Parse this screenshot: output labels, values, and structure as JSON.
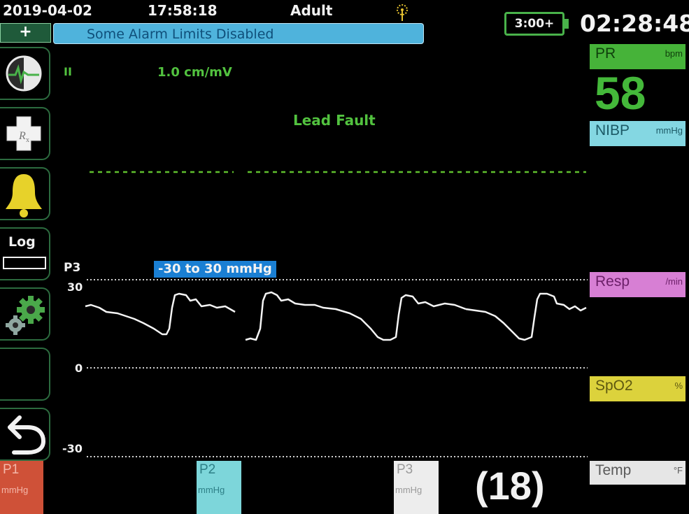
{
  "status_bar": {
    "date": "2019-04-02",
    "time": "17:58:18",
    "patient_type": "Adult",
    "battery_label": "3:00+",
    "elapsed_clock": "02:28:48",
    "plus_symbol": "+",
    "alarm_message": "Some Alarm Limits Disabled"
  },
  "sidebar": {
    "items": [
      {
        "icon": "heart-monitor-icon"
      },
      {
        "icon": "rx-cross-icon"
      },
      {
        "icon": "alarm-bell-icon"
      },
      {
        "icon": "log-icon",
        "label": "Log"
      },
      {
        "icon": "settings-gears-icon"
      },
      {
        "icon": "blank"
      },
      {
        "icon": "back-arrow-icon"
      }
    ]
  },
  "ecg": {
    "lead": "II",
    "gain": "1.0 cm/mV",
    "message": "Lead Fault"
  },
  "pressure": {
    "channel": "P3",
    "scale": "-30 to 30 mmHg",
    "ticks": [
      "30",
      "0",
      "-30"
    ]
  },
  "params": {
    "pr": {
      "label": "PR",
      "unit": "bpm",
      "value": "58",
      "color": "#46b339"
    },
    "nibp": {
      "label": "NIBP",
      "unit": "mmHg",
      "color": "#84d7e2"
    },
    "resp": {
      "label": "Resp",
      "unit": "/min",
      "color": "#d77fd4"
    },
    "spo2": {
      "label": "SpO2",
      "unit": "%",
      "color": "#dcd23c"
    },
    "temp": {
      "label": "Temp",
      "unit": "°F",
      "color": "#e6e6e6"
    }
  },
  "bottom": {
    "p1": {
      "label": "P1",
      "unit": "mmHg"
    },
    "p2": {
      "label": "P2",
      "unit": "mmHg"
    },
    "p3": {
      "label": "P3",
      "unit": "mmHg"
    },
    "mean": "(18)"
  }
}
